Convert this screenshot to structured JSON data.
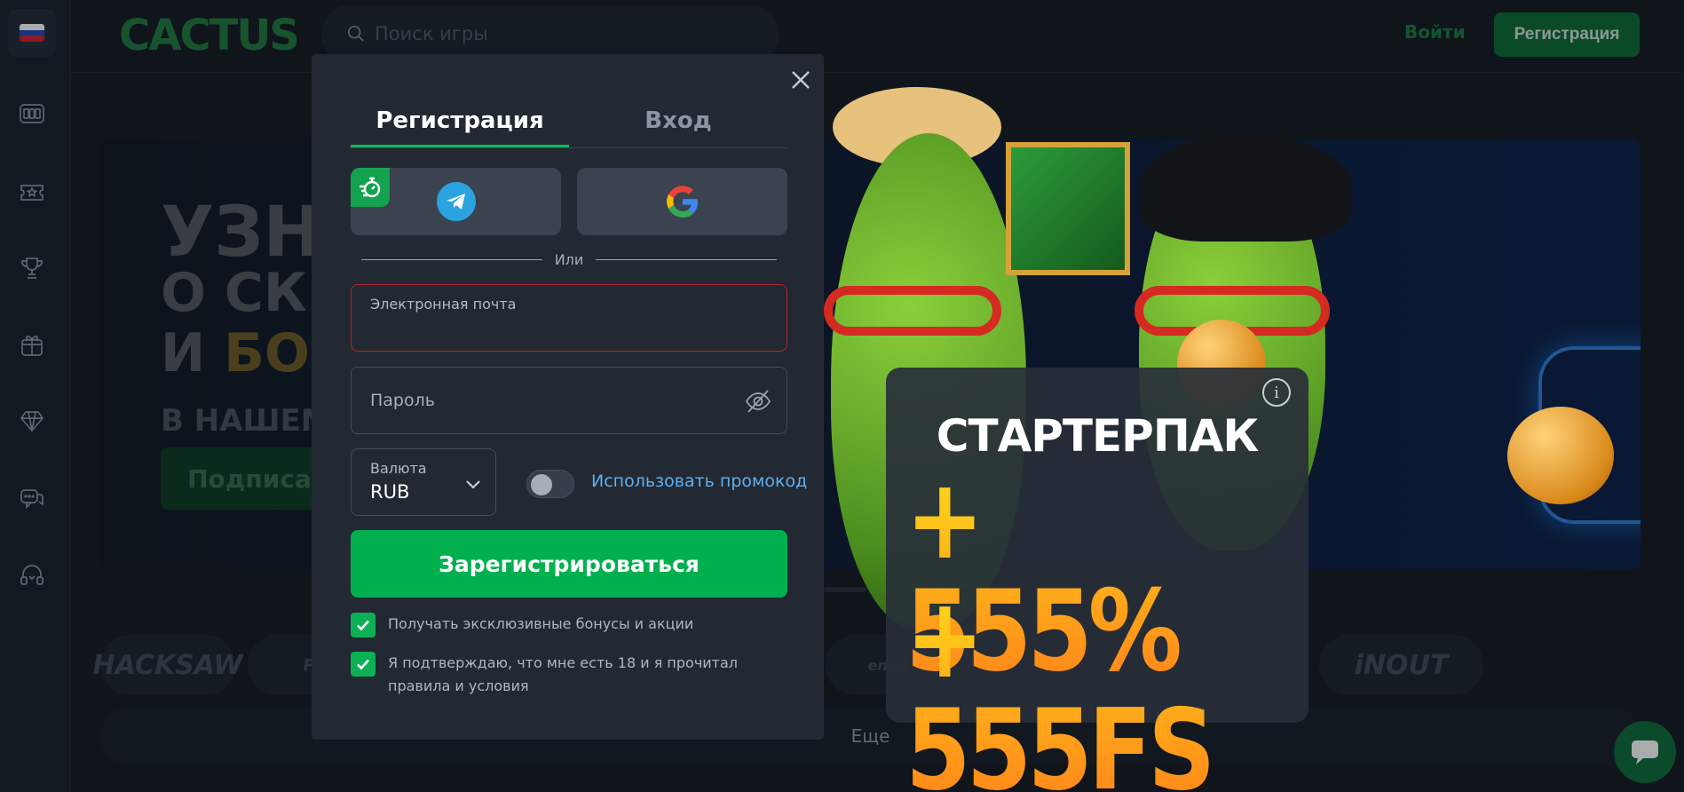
{
  "app": {
    "logo_text": "CACTUS"
  },
  "header": {
    "search_placeholder": "Поиск игры",
    "login_label": "Войти",
    "register_label": "Регистрация"
  },
  "sidebar": {
    "items": [
      {
        "name": "language-russian",
        "icon": "flag-ru-icon"
      },
      {
        "name": "slots",
        "icon": "slot-machine-icon"
      },
      {
        "name": "live",
        "icon": "ticket-icon"
      },
      {
        "name": "tournaments",
        "icon": "trophy-icon"
      },
      {
        "name": "bonuses",
        "icon": "gift-icon"
      },
      {
        "name": "vip",
        "icon": "diamond-icon"
      },
      {
        "name": "chat",
        "icon": "chat-icon"
      },
      {
        "name": "support",
        "icon": "headset-icon"
      }
    ]
  },
  "banner": {
    "line1": "УЗН",
    "line2": "О СКР",
    "line3_a": "И ",
    "line3_b": "БО",
    "line4": "В НАШЕМ",
    "button": "Подписа"
  },
  "providers": [
    "HACKSAW",
    "PR",
    "endo",
    "iNOUT"
  ],
  "more_label": "Еще",
  "modal": {
    "tabs": [
      {
        "label": "Регистрация",
        "active": true
      },
      {
        "label": "Вход",
        "active": false
      }
    ],
    "or_label": "Или",
    "email": {
      "label": "Электронная почта",
      "value": ""
    },
    "password": {
      "label": "Пароль",
      "value": ""
    },
    "currency": {
      "label": "Валюта",
      "value": "RUB"
    },
    "promo_toggle": {
      "on": false
    },
    "promo_link": "Использовать промокод",
    "submit": "Зарегистрироваться",
    "checks": [
      {
        "checked": true,
        "text": "Получать эксклюзивные бонусы и акции"
      },
      {
        "checked": true,
        "text": "Я подтверждаю, что мне есть 18 и я прочитал правила и условия"
      }
    ]
  },
  "promo": {
    "title": "СТАРТЕРПАК",
    "line1": "+ 555%",
    "line2": "+ 555FS"
  },
  "colors": {
    "accent": "#00b04f",
    "error_border": "#b3262a",
    "link": "#5fb0ee",
    "promo_gold": "#ffb31a"
  }
}
